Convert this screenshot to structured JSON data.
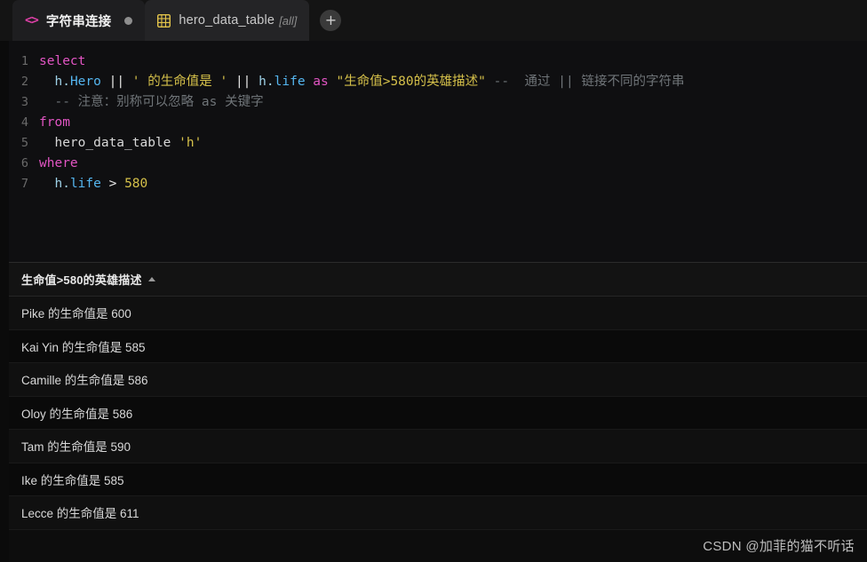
{
  "tabs": [
    {
      "icon": "code-brackets-icon",
      "label": "字符串连接",
      "suffix": "",
      "active": true,
      "dirty": true
    },
    {
      "icon": "table-grid-icon",
      "label": "hero_data_table",
      "suffix": "[all]",
      "active": false,
      "dirty": false
    }
  ],
  "add_tab": {
    "label": "+",
    "name": "add-tab-button"
  },
  "editor": {
    "lines": [
      {
        "n": "1",
        "tokens": [
          {
            "t": "kw",
            "v": "select"
          }
        ]
      },
      {
        "n": "2",
        "tokens": [
          {
            "t": "plain",
            "v": "  "
          },
          {
            "t": "dot",
            "v": "h."
          },
          {
            "t": "col",
            "v": "Hero"
          },
          {
            "t": "plain",
            "v": " "
          },
          {
            "t": "op",
            "v": "||"
          },
          {
            "t": "plain",
            "v": " "
          },
          {
            "t": "str",
            "v": "' 的生命值是 '"
          },
          {
            "t": "plain",
            "v": " "
          },
          {
            "t": "op",
            "v": "||"
          },
          {
            "t": "plain",
            "v": " "
          },
          {
            "t": "dot",
            "v": "h."
          },
          {
            "t": "col",
            "v": "life"
          },
          {
            "t": "plain",
            "v": " "
          },
          {
            "t": "kw",
            "v": "as"
          },
          {
            "t": "plain",
            "v": " "
          },
          {
            "t": "str",
            "v": "\"生命值>580的英雄描述\""
          },
          {
            "t": "plain",
            "v": " "
          },
          {
            "t": "com",
            "v": "--  通过 || 链接不同的字符串"
          }
        ]
      },
      {
        "n": "3",
        "tokens": [
          {
            "t": "plain",
            "v": "  "
          },
          {
            "t": "com",
            "v": "-- 注意：别称可以忽略 as 关键字"
          }
        ]
      },
      {
        "n": "4",
        "tokens": [
          {
            "t": "kw",
            "v": "from"
          }
        ]
      },
      {
        "n": "5",
        "tokens": [
          {
            "t": "plain",
            "v": "  "
          },
          {
            "t": "plain",
            "v": "hero_data_table"
          },
          {
            "t": "plain",
            "v": " "
          },
          {
            "t": "str",
            "v": "'h'"
          }
        ]
      },
      {
        "n": "6",
        "tokens": [
          {
            "t": "kw",
            "v": "where"
          }
        ]
      },
      {
        "n": "7",
        "tokens": [
          {
            "t": "plain",
            "v": "  "
          },
          {
            "t": "dot",
            "v": "h."
          },
          {
            "t": "col",
            "v": "life"
          },
          {
            "t": "plain",
            "v": " "
          },
          {
            "t": "op",
            "v": ">"
          },
          {
            "t": "plain",
            "v": " "
          },
          {
            "t": "num",
            "v": "580"
          }
        ]
      }
    ]
  },
  "results": {
    "column_header": "生命值>580的英雄描述",
    "sort_direction": "ascending",
    "rows": [
      "Pike 的生命值是 600",
      "Kai Yin 的生命值是 585",
      "Camille 的生命值是 586",
      "Oloy 的生命值是 586",
      "Tam 的生命值是 590",
      "Ike 的生命值是 585",
      "Lecce 的生命值是 611"
    ]
  },
  "watermark": "CSDN @加菲的猫不听话",
  "colors": {
    "page_bg": "#0b0b0b",
    "tabbar_bg": "#141414",
    "active_tab_bg": "#1e1e20",
    "inactive_tab_bg": "#242426",
    "editor_bg": "#0f0f11",
    "accent_pink": "#e255c4",
    "accent_blue": "#55b6f0",
    "accent_yellow": "#d6c14a",
    "table_icon": "#e3c44a",
    "code_icon": "#e040a8"
  }
}
